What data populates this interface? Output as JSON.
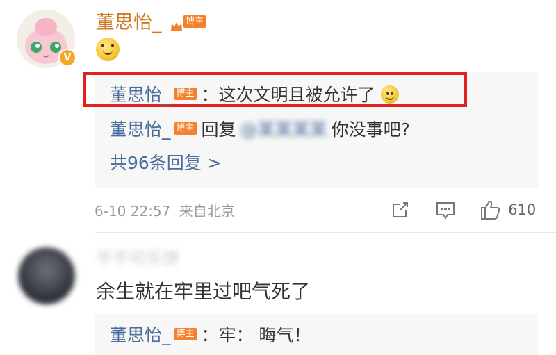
{
  "post": {
    "author": "董思怡_",
    "badge": "博主",
    "content_emoji": "smile-emoji",
    "replies": [
      {
        "author": "董思怡_",
        "badge": "博主",
        "text": "：这次文明且被允许了",
        "emoji": "smile-emoji"
      },
      {
        "author": "董思怡_",
        "badge": "博主",
        "prefix": "回复",
        "mention": "@某某某某",
        "text": "你没事吧?"
      }
    ],
    "more_replies": "共96条回复 >",
    "timestamp": "6-10 22:57",
    "location": "来自北京",
    "like_count": "610"
  },
  "comment2": {
    "author": "平平可乐饼",
    "text": "余生就在牢里过吧气死了",
    "replies": [
      {
        "author": "董思怡_",
        "badge": "博主",
        "text": "：牢：  晦气！"
      }
    ]
  },
  "colors": {
    "highlight": "#e0231e",
    "author": "#d27a23",
    "link": "#4a6e9b",
    "badge": "#f5812c",
    "reply_bg": "#f7f7f7"
  }
}
